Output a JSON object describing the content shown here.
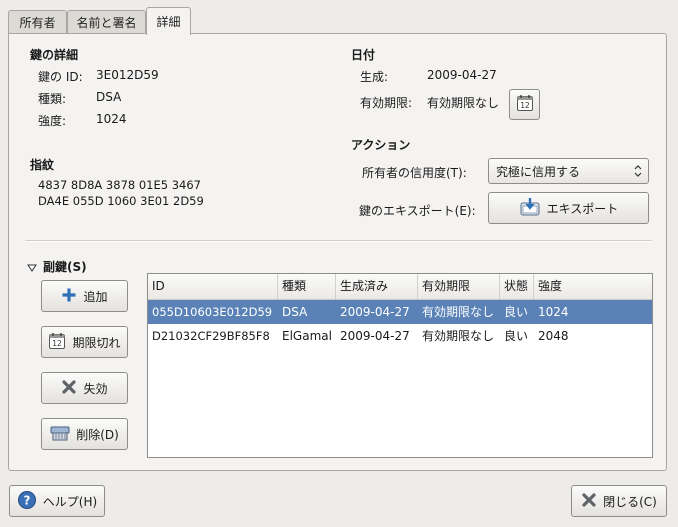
{
  "tabs": [
    {
      "label": "所有者"
    },
    {
      "label": "名前と署名"
    },
    {
      "label": "詳細"
    }
  ],
  "key_details": {
    "heading": "鍵の詳細",
    "id_label": "鍵の ID:",
    "id_value": "3E012D59",
    "type_label": "種類:",
    "type_value": "DSA",
    "strength_label": "強度:",
    "strength_value": "1024"
  },
  "fingerprint": {
    "heading": "指紋",
    "line1": "4837 8D8A 3878 01E5 3467",
    "line2": "DA4E 055D 1060 3E01 2D59"
  },
  "dates": {
    "heading": "日付",
    "created_label": "生成:",
    "created_value": "2009-04-27",
    "expires_label": "有効期限:",
    "expires_value": "有効期限なし"
  },
  "actions": {
    "heading": "アクション",
    "trust_label": "所有者の信用度(T):",
    "trust_value": "究極に信用する",
    "export_label": "鍵のエキスポート(E):",
    "export_button": "エキスポート"
  },
  "subkeys": {
    "heading": "副鍵(S)",
    "buttons": {
      "add": "追加",
      "expire": "期限切れ",
      "revoke": "失効",
      "delete": "削除(D)"
    },
    "columns": [
      "ID",
      "種類",
      "生成済み",
      "有効期限",
      "状態",
      "強度"
    ],
    "rows": [
      {
        "id": "055D10603E012D59",
        "type": "DSA",
        "created": "2009-04-27",
        "expires": "有効期限なし",
        "status": "良い",
        "strength": "1024",
        "selected": true
      },
      {
        "id": "D21032CF29BF85F8",
        "type": "ElGamal",
        "created": "2009-04-27",
        "expires": "有効期限なし",
        "status": "良い",
        "strength": "2048",
        "selected": false
      }
    ]
  },
  "footer": {
    "help": "ヘルプ(H)",
    "close": "閉じる(C)"
  },
  "colors": {
    "selection": "#5a82b7",
    "window_bg": "#edeceb",
    "help_icon": "#3b6fb6"
  },
  "icons": [
    "calendar-icon",
    "export-icon",
    "plus-icon",
    "calendar-icon",
    "x-icon",
    "trash-icon",
    "help-icon",
    "close-icon",
    "triangle-down-icon"
  ]
}
